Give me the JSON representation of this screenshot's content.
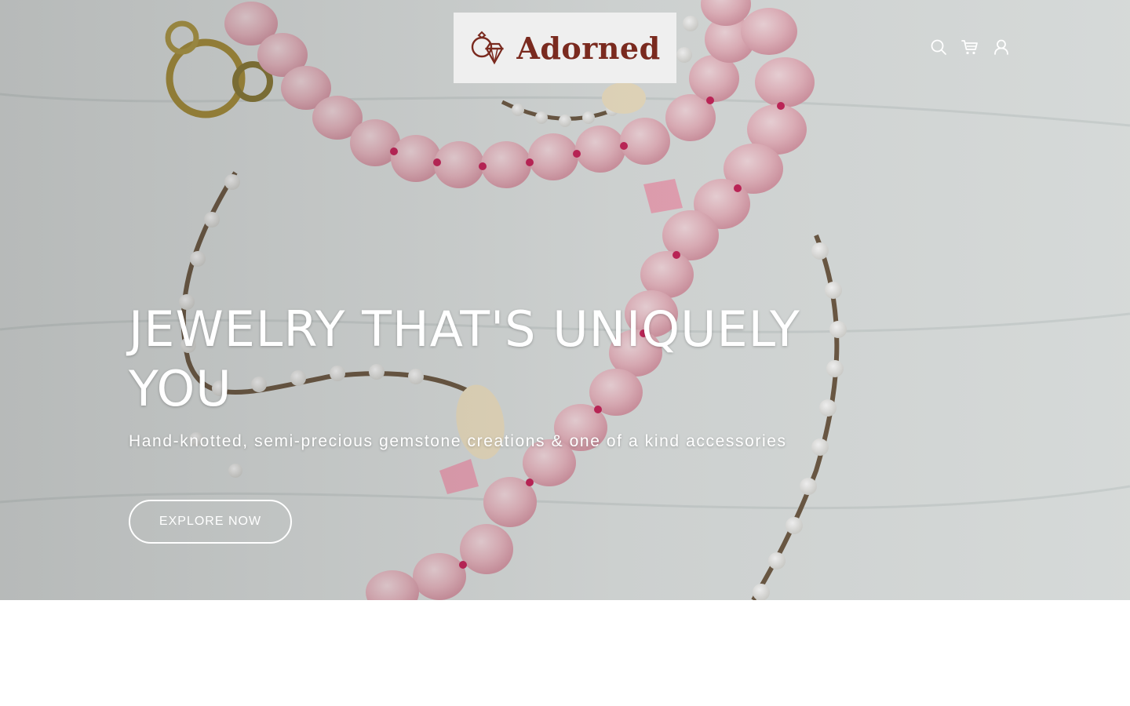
{
  "brand": {
    "name": "Adorned",
    "logo_icon": "ring-diamond-icon",
    "color": "#7a2a1f"
  },
  "header": {
    "icons": [
      "search-icon",
      "cart-icon",
      "account-icon"
    ]
  },
  "hero": {
    "title": "JEWELRY THAT'S UNIQUELY YOU",
    "subtitle": "Hand-knotted, semi-precious gemstone creations & one of a kind accessories",
    "cta_label": "EXPLORE NOW",
    "text_color": "#ffffff"
  }
}
